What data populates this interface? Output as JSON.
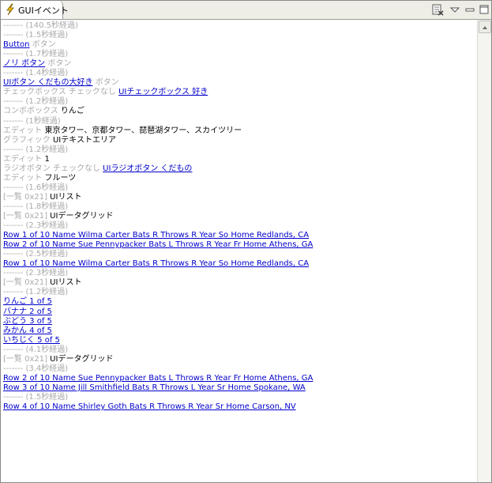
{
  "tab": {
    "title": "GUIイベント"
  },
  "toolbar": {
    "icons": [
      "clear-console-icon",
      "view-menu-icon",
      "minimize-icon",
      "maximize-icon"
    ]
  },
  "lines": [
    {
      "segs": [
        {
          "t": "------- (140.5秒経過)",
          "c": "g"
        }
      ]
    },
    {
      "segs": [
        {
          "t": "------- (1.5秒経過)",
          "c": "g"
        }
      ]
    },
    {
      "segs": [
        {
          "t": "Button",
          "c": "a"
        },
        {
          "t": " ボタン",
          "c": "g"
        }
      ]
    },
    {
      "segs": [
        {
          "t": "------- (1.7秒経過)",
          "c": "g"
        }
      ]
    },
    {
      "segs": [
        {
          "t": "ノリ ボタン",
          "c": "a"
        },
        {
          "t": " ボタン",
          "c": "g"
        }
      ]
    },
    {
      "segs": [
        {
          "t": "------- (1.4秒経過)",
          "c": "g"
        }
      ]
    },
    {
      "segs": [
        {
          "t": "UIボタン くだもの大好き",
          "c": "a"
        },
        {
          "t": " ボタン",
          "c": "g"
        }
      ]
    },
    {
      "segs": [
        {
          "t": "チェックボックス チェックなし ",
          "c": "g"
        },
        {
          "t": "UIチェックボックス 好き",
          "c": "a"
        }
      ]
    },
    {
      "segs": [
        {
          "t": "------- (1.2秒経過)",
          "c": "g"
        }
      ]
    },
    {
      "segs": [
        {
          "t": "コンボボックス ",
          "c": "g"
        },
        {
          "t": "りんご",
          "c": "b"
        }
      ]
    },
    {
      "segs": [
        {
          "t": "------- (1秒経過)",
          "c": "g"
        }
      ]
    },
    {
      "segs": [
        {
          "t": "エディット ",
          "c": "g"
        },
        {
          "t": "東京タワー、京都タワー、琵琶湖タワー、スカイツリー",
          "c": "b"
        }
      ]
    },
    {
      "segs": [
        {
          "t": "グラフィック ",
          "c": "g"
        },
        {
          "t": "UIテキストエリア",
          "c": "b"
        }
      ]
    },
    {
      "segs": [
        {
          "t": "------- (1.2秒経過)",
          "c": "g"
        }
      ]
    },
    {
      "segs": [
        {
          "t": "エディット ",
          "c": "g"
        },
        {
          "t": "1",
          "c": "b"
        }
      ]
    },
    {
      "segs": [
        {
          "t": "ラジオボタン チェックなし ",
          "c": "g"
        },
        {
          "t": "UIラジオボタン くだもの",
          "c": "a"
        }
      ]
    },
    {
      "segs": [
        {
          "t": "エディット ",
          "c": "g"
        },
        {
          "t": "フルーツ",
          "c": "b"
        }
      ]
    },
    {
      "segs": [
        {
          "t": "------- (1.6秒経過)",
          "c": "g"
        }
      ]
    },
    {
      "segs": [
        {
          "t": "[一覧 0x21] ",
          "c": "g"
        },
        {
          "t": "UIリスト",
          "c": "b"
        }
      ]
    },
    {
      "segs": [
        {
          "t": "------- (1.8秒経過)",
          "c": "g"
        }
      ]
    },
    {
      "segs": [
        {
          "t": "[一覧 0x21] ",
          "c": "g"
        },
        {
          "t": "UIデータグリッド",
          "c": "b"
        }
      ]
    },
    {
      "segs": [
        {
          "t": "------- (2.3秒経過)",
          "c": "g"
        }
      ]
    },
    {
      "segs": [
        {
          "t": "Row 1 of 10 Name Wilma Carter Bats R Throws R Year So Home Redlands, CA",
          "c": "a"
        }
      ]
    },
    {
      "segs": [
        {
          "t": "Row 2 of 10 Name Sue Pennypacker Bats L Throws R Year Fr Home Athens, GA",
          "c": "a"
        }
      ]
    },
    {
      "segs": [
        {
          "t": "------- (2.5秒経過)",
          "c": "g"
        }
      ]
    },
    {
      "segs": [
        {
          "t": "Row 1 of 10 Name Wilma Carter Bats R Throws R Year So Home Redlands, CA",
          "c": "a"
        }
      ]
    },
    {
      "segs": [
        {
          "t": "------- (2.3秒経過)",
          "c": "g"
        }
      ]
    },
    {
      "segs": [
        {
          "t": "[一覧 0x21] ",
          "c": "g"
        },
        {
          "t": "UIリスト",
          "c": "b"
        }
      ]
    },
    {
      "segs": [
        {
          "t": "------- (1.2秒経過)",
          "c": "g"
        }
      ]
    },
    {
      "segs": [
        {
          "t": "りんご 1 of 5",
          "c": "a"
        }
      ]
    },
    {
      "segs": [
        {
          "t": "バナナ 2 of 5",
          "c": "a"
        }
      ]
    },
    {
      "segs": [
        {
          "t": "ぶどう 3 of 5",
          "c": "a"
        }
      ]
    },
    {
      "segs": [
        {
          "t": "みかん 4 of 5",
          "c": "a"
        }
      ]
    },
    {
      "segs": [
        {
          "t": "いちじく 5 of 5",
          "c": "a"
        }
      ]
    },
    {
      "segs": [
        {
          "t": "------- (4.1秒経過)",
          "c": "g"
        }
      ]
    },
    {
      "segs": [
        {
          "t": "[一覧 0x21] ",
          "c": "g"
        },
        {
          "t": "UIデータグリッド",
          "c": "b"
        }
      ]
    },
    {
      "segs": [
        {
          "t": "------- (3.4秒経過)",
          "c": "g"
        }
      ]
    },
    {
      "segs": [
        {
          "t": "Row 2 of 10 Name Sue Pennypacker Bats L Throws R Year Fr Home Athens, GA",
          "c": "a"
        }
      ]
    },
    {
      "segs": [
        {
          "t": "Row 3 of 10 Name Jill Smithfield Bats R Throws L Year Sr Home Spokane, WA",
          "c": "a"
        }
      ]
    },
    {
      "segs": [
        {
          "t": "------- (1.5秒経過)",
          "c": "g"
        }
      ]
    },
    {
      "segs": [
        {
          "t": "Row 4 of 10 Name Shirley Goth Bats R Throws R Year Sr Home Carson, NV",
          "c": "a"
        }
      ]
    }
  ]
}
